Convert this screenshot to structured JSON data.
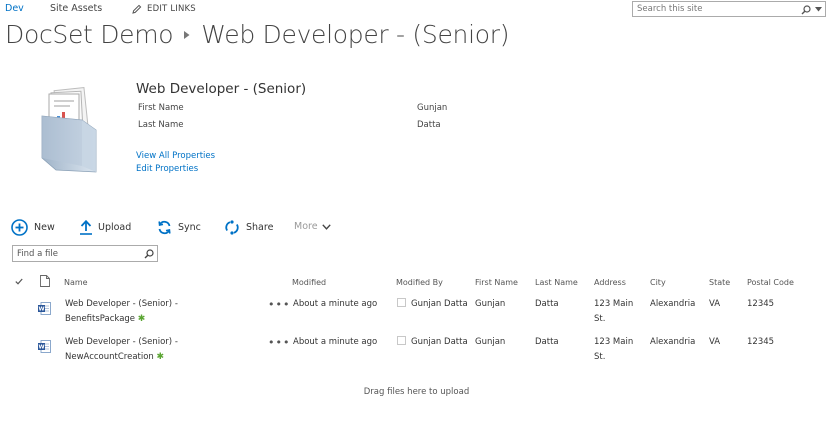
{
  "topnav": {
    "items": [
      {
        "label": "Dev",
        "active": true
      },
      {
        "label": "Site Assets",
        "active": false
      }
    ],
    "edit_links": "EDIT LINKS"
  },
  "search": {
    "placeholder": "Search this site"
  },
  "breadcrumb": {
    "site": "DocSet Demo",
    "page": "Web Developer - (Senior)"
  },
  "docset": {
    "title": "Web Developer - (Senior)",
    "properties": [
      {
        "label": "First Name",
        "value": "Gunjan"
      },
      {
        "label": "Last Name",
        "value": "Datta"
      }
    ],
    "links": {
      "view_all": "View All Properties",
      "edit": "Edit Properties"
    }
  },
  "commands": {
    "new": "New",
    "upload": "Upload",
    "sync": "Sync",
    "share": "Share",
    "more": "More"
  },
  "find": {
    "placeholder": "Find a file"
  },
  "table": {
    "columns": [
      "Name",
      "Modified",
      "Modified By",
      "First Name",
      "Last Name",
      "Address",
      "City",
      "State",
      "Postal Code"
    ],
    "rows": [
      {
        "name_line1": "Web Developer - (Senior) -",
        "name_line2": "BenefitsPackage",
        "modified": "About a minute ago",
        "modified_by": "Gunjan Datta",
        "first_name": "Gunjan",
        "last_name": "Datta",
        "address_line1": "123 Main",
        "address_line2": "St.",
        "city": "Alexandria",
        "state": "VA",
        "postal_code": "12345"
      },
      {
        "name_line1": "Web Developer - (Senior) -",
        "name_line2": "NewAccountCreation",
        "modified": "About a minute ago",
        "modified_by": "Gunjan Datta",
        "first_name": "Gunjan",
        "last_name": "Datta",
        "address_line1": "123 Main",
        "address_line2": "St.",
        "city": "Alexandria",
        "state": "VA",
        "postal_code": "12345"
      }
    ]
  },
  "drop_hint": "Drag files here to upload",
  "colors": {
    "accent": "#0072c6",
    "text": "#444444",
    "new_tag": "#5aa532"
  },
  "icons": {
    "new": "plus-circle-icon",
    "upload": "upload-arrow-icon",
    "sync": "sync-icon",
    "share": "share-icon",
    "more": "chevron-down-icon",
    "docset": "document-set-icon",
    "word": "word-document-icon"
  }
}
